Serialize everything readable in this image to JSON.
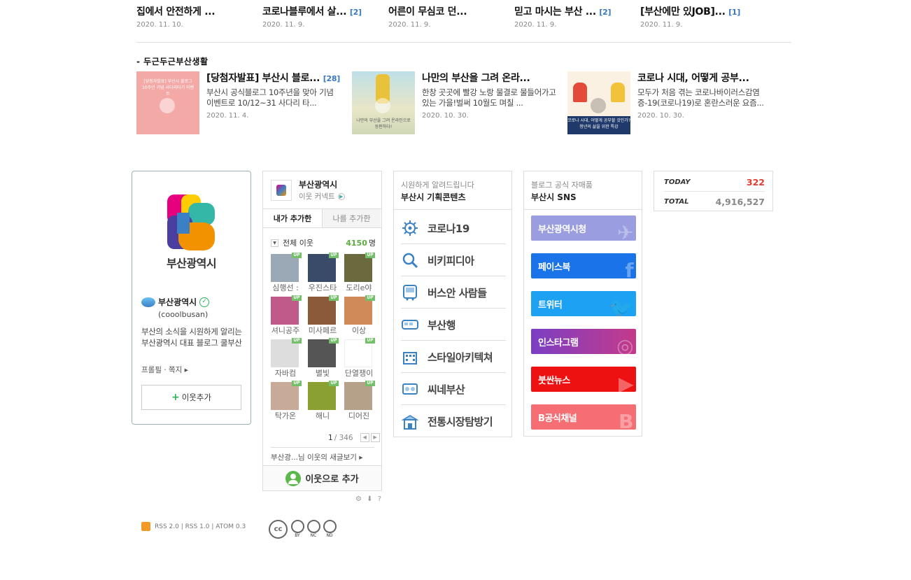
{
  "top_posts": [
    {
      "title": "집에서 안전하게 ...",
      "count": "",
      "date": "2020. 11. 10."
    },
    {
      "title": "코로나블루에서 살...",
      "count": "[2]",
      "date": "2020. 11. 9."
    },
    {
      "title": "어른이 무심코 던...",
      "count": "",
      "date": "2020. 11. 9."
    },
    {
      "title": "믿고 마시는 부산 ...",
      "count": "[2]",
      "date": "2020. 11. 9."
    },
    {
      "title": "[부산에만 있JOB]...",
      "count": "[1]",
      "date": "2020. 11. 9."
    }
  ],
  "section_title": "- 두근두근부산생활",
  "cards": [
    {
      "title": "[당첨자발표] 부산시 블로...",
      "count": "[28]",
      "desc": "부산시 공식블로그 10주년을 맞아 기념 이벤트로 10/12~31 사다리 타...",
      "date": "2020. 11. 4.",
      "thumb_caption": "[당첨자발표] 부산시 블로그 10주년 기념 사다리타기 이벤트"
    },
    {
      "title": "나만의 부산을 그려 온라...",
      "count": "",
      "desc": "한창 곳곳에 빨강 노랑 물결로 물들어가고 있는 가을!벌써 10월도 며칠 ...",
      "date": "2020. 10. 30.",
      "thumb_caption": "나만의 부산을 그려 온라인으로 등판하다!"
    },
    {
      "title": "코로나 시대, 어떻게 공부...",
      "count": "",
      "desc": "모두가 처음 겪는 코로나바이러스감염증-19(코로나19)로 혼란스러운 요즘...",
      "date": "2020. 10. 30.",
      "thumb_caption": "코로나 시대, 어떻게 공부할 것인가? 청년의 삶을 위한 특강"
    }
  ],
  "profile": {
    "logo_text": "부산광역시",
    "name": "부산광역시",
    "id": "(cooolbusan)",
    "desc": "부산의 소식을 시원하게 알리는 부산광역시 대표 블로그 쿨부산",
    "links": "프롤필 · 쪽지 ▸",
    "add_label": "이웃추가"
  },
  "neighbor": {
    "title": "부산광역시",
    "sub": "이웃 커넥트",
    "tabs": [
      "내가 추가한",
      "나를 추가한"
    ],
    "all_label": "전체 이웃",
    "all_count": "4150",
    "unit": "명",
    "up_badge": "UP",
    "friends": [
      {
        "name": "심행선 :",
        "color": "#9aa9b5"
      },
      {
        "name": "우진스타",
        "color": "#3a4b6a"
      },
      {
        "name": "도리e야",
        "color": "#6b6a3e"
      },
      {
        "name": "셔니공주",
        "color": "#c05a8a"
      },
      {
        "name": "미사페르",
        "color": "#8a5a3a"
      },
      {
        "name": "이상",
        "color": "#d08a5a"
      },
      {
        "name": "자바컴",
        "color": "#dddddd"
      },
      {
        "name": "별빛",
        "color": "#555555"
      },
      {
        "name": "단열쟁이",
        "color": "#ffffff"
      },
      {
        "name": "탁가온",
        "color": "#c8aa98"
      },
      {
        "name": "해니",
        "color": "#8aa033"
      },
      {
        "name": "디어진",
        "color": "#b5a08a"
      }
    ],
    "page_current": "1",
    "page_total": "/ 346",
    "news_label": "부산광...님 이웃의 새글보기 ▸",
    "add_label": "이웃으로 추가",
    "tools": "⚙ ⬇ ?"
  },
  "contents": {
    "sub": "시원하게 알려드립니다",
    "title": "부산시 기획콘텐츠",
    "items": [
      {
        "label": "코로나19",
        "icon": "virus-icon"
      },
      {
        "label": "비키피디아",
        "icon": "magnifier-icon"
      },
      {
        "label": "버스안 사람들",
        "icon": "bus-icon"
      },
      {
        "label": "부산행",
        "icon": "train-icon"
      },
      {
        "label": "스타일아키텍쳐",
        "icon": "building-icon"
      },
      {
        "label": "씨네부산",
        "icon": "film-icon"
      },
      {
        "label": "전통시장탐방기",
        "icon": "market-icon"
      }
    ]
  },
  "sns": {
    "sub": "블로그 공식 자매품",
    "title": "부산시 SNS",
    "items": [
      {
        "label": "부산광역시청",
        "color": "#9a9de0"
      },
      {
        "label": "페이스북",
        "color": "#1a73e8"
      },
      {
        "label": "트위터",
        "color": "#1da1f2"
      },
      {
        "label": "인스타그램",
        "color": "#a23aa8"
      },
      {
        "label": "붓싼뉴스",
        "color": "#ee1111"
      },
      {
        "label": "B공식채널",
        "color": "#f56e74"
      }
    ]
  },
  "counter": {
    "today_label": "TODAY",
    "today_value": "322",
    "total_label": "TOTAL",
    "total_value": "4,916,527",
    "today_color": "#e23a2f"
  },
  "footer": {
    "rss": "RSS 2.0 | RSS 1.0 | ATOM 0.3",
    "cc": [
      "BY",
      "NC",
      "ND"
    ]
  }
}
